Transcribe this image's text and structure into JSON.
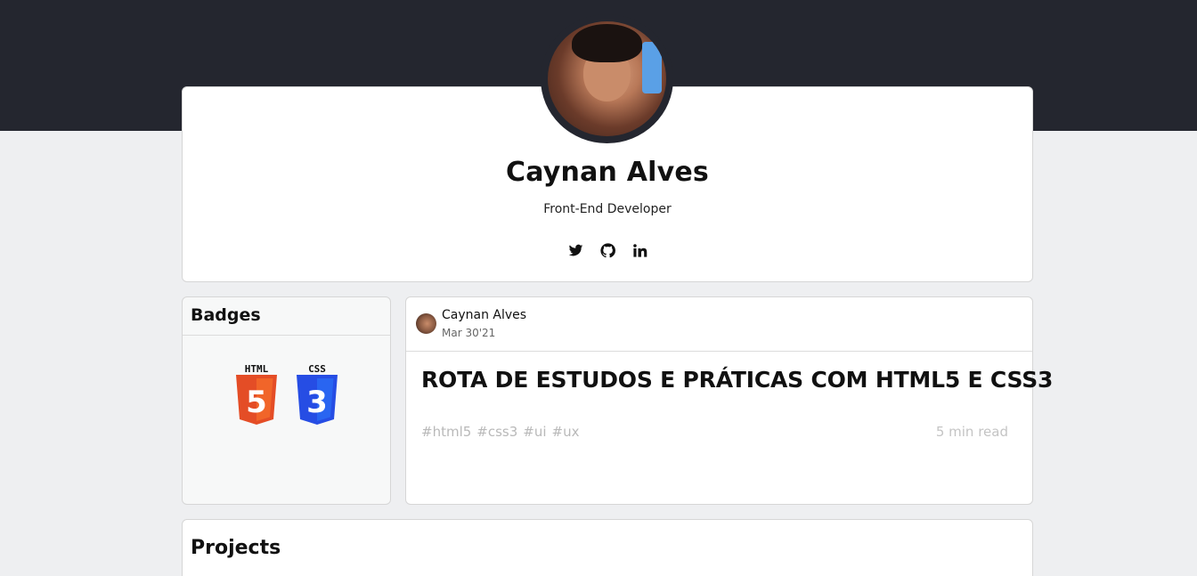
{
  "profile": {
    "name": "Caynan Alves",
    "role": "Front-End Developer",
    "social": [
      "twitter-icon",
      "github-icon",
      "linkedin-icon"
    ]
  },
  "badges": {
    "title": "Badges",
    "items": [
      {
        "label": "HTML",
        "number": "5",
        "color": "#e44d26",
        "icon": "html5-icon"
      },
      {
        "label": "CSS",
        "number": "3",
        "color": "#264de4",
        "icon": "css3-icon"
      }
    ]
  },
  "post": {
    "author": "Caynan Alves",
    "date": "Mar 30'21",
    "title": "ROTA DE ESTUDOS E PRÁTICAS COM HTML5 E CSS3",
    "tags": [
      "#html5",
      "#css3",
      "#ui",
      "#ux"
    ],
    "read_time": "5 min read"
  },
  "projects": {
    "title": "Projects"
  },
  "colors": {
    "header_bg": "#24262f",
    "page_bg": "#eeeff1"
  }
}
